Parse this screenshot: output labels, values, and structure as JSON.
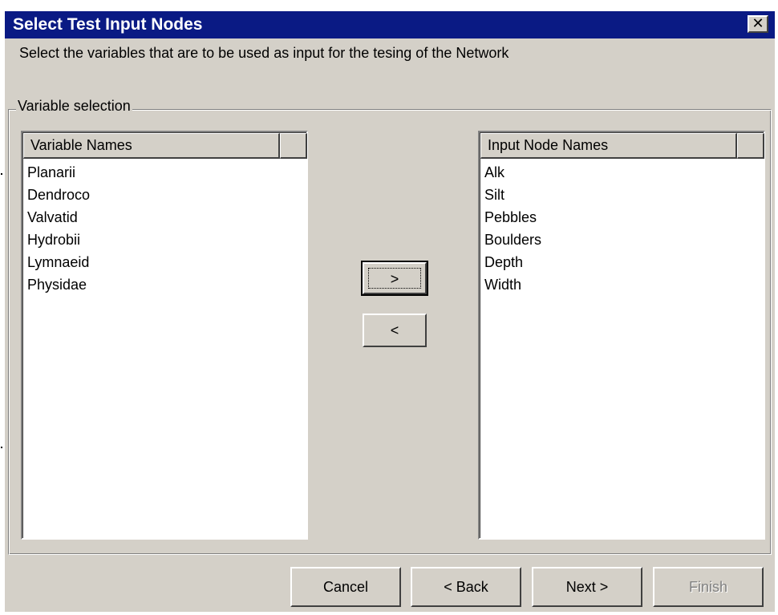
{
  "window": {
    "title": "Select Test Input Nodes",
    "close_glyph": "✕"
  },
  "instruction": "Select the variables that are to be used as input for the tesing of the Network",
  "variable_selection": {
    "group_label": "Variable selection",
    "available_list": {
      "header": "Variable Names",
      "items": [
        "Planarii",
        "Dendroco",
        "Valvatid",
        "Hydrobii",
        "Lymnaeid",
        "Physidae"
      ]
    },
    "selected_list": {
      "header": "Input Node Names",
      "items": [
        "Alk",
        "Silt",
        "Pebbles",
        "Boulders",
        "Depth",
        "Width"
      ]
    },
    "add_button_label": ">",
    "remove_button_label": "<"
  },
  "footer": {
    "cancel_label": "Cancel",
    "back_label": "< Back",
    "next_label": "Next >",
    "finish_label": "Finish"
  },
  "colors": {
    "titlebar": "#0a1a84",
    "dialog_face": "#d4d0c8",
    "disabled_text": "#808080"
  }
}
